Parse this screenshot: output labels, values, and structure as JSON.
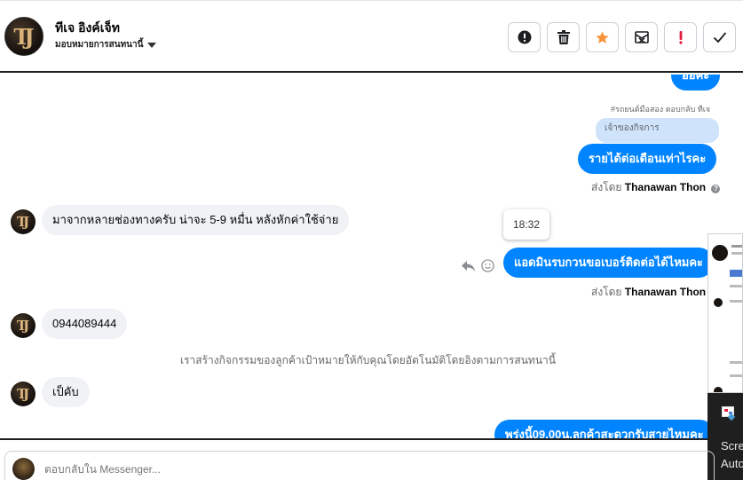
{
  "header": {
    "name": "ทีเจ อิงค์เจ็ท",
    "assign_label": "มอบหมายการสนทนานี้",
    "avatar_text": "TJ"
  },
  "toolbar": {
    "buttons": [
      {
        "name": "spam-button",
        "icon": "exclamation-circle-icon"
      },
      {
        "name": "delete-button",
        "icon": "trash-icon"
      },
      {
        "name": "star-button",
        "icon": "star-icon",
        "color": "#f7923a"
      },
      {
        "name": "archive-button",
        "icon": "envelope-x-icon"
      },
      {
        "name": "important-button",
        "icon": "exclamation-icon",
        "color": "#e41e3f"
      },
      {
        "name": "done-button",
        "icon": "checkmark-icon"
      }
    ]
  },
  "chat": {
    "top_partial_bubble": "ออคะ",
    "reply_note": "#รถยนต์มือสอง ตอบกลับ ทีเจ",
    "quoted_label": "เจ้าของกิจการ",
    "out_msg_1": "รายได้ต่อเดือนเท่าไรคะ",
    "sent_by_1_prefix": "ส่งโดย",
    "sent_by_1_name": "Thanawan Thon",
    "in_msg_1": "มาจากหลายช่องทางครับ น่าจะ 5-9 หมื่น  หลังหักค่าใช้จ่าย",
    "timestamp": "18:32",
    "out_msg_2": "แอดมินรบกวนขอเบอร์ติดต่อได้ไหมคะ",
    "sent_by_2_prefix": "ส่งโดย",
    "sent_by_2_name": "Thanawan Thon",
    "in_msg_2": "0944089444",
    "system_msg": "เราสร้างกิจกรรมของลูกค้าเป้าหมายให้กับคุณโดยอัตโนมัติโดยอิงตามการสนทนานี้",
    "in_msg_3": "เป็คับ",
    "out_msg_3": "พรุ่งนี้09.00น.ลูกค้าสะดวกรับสายไหมคะ"
  },
  "composer": {
    "placeholder": "ตอบกลับใน Messenger..."
  },
  "overlay": {
    "line1": "Scre",
    "line2": "Auto"
  },
  "colors": {
    "accent": "#0084ff",
    "bubble_in": "#f0f2f5",
    "star": "#f7923a",
    "important": "#e41e3f"
  }
}
